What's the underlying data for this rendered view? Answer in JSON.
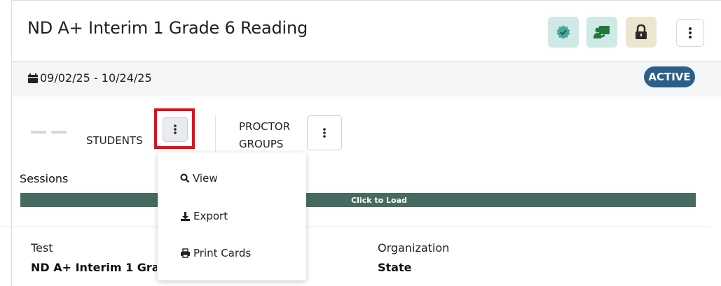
{
  "header": {
    "title": "ND A+ Interim 1 Grade 6 Reading",
    "icons": [
      "verified-badge-icon",
      "proctor-icon",
      "lock-icon",
      "more-vertical-icon"
    ]
  },
  "datebar": {
    "date_range": "09/02/25 - 10/24/25",
    "status": "ACTIVE"
  },
  "stats": {
    "students_label": "STUDENTS",
    "proctor_groups_line1": "PROCTOR",
    "proctor_groups_line2": "GROUPS"
  },
  "sessions": {
    "label": "Sessions",
    "load_label": "Click to Load"
  },
  "dropdown": {
    "items": [
      {
        "label": "View",
        "icon": "search-icon"
      },
      {
        "label": "Export",
        "icon": "download-icon"
      },
      {
        "label": "Print Cards",
        "icon": "print-icon"
      }
    ]
  },
  "fields": {
    "test_label": "Test",
    "test_value": "ND A+ Interim 1 Gra",
    "org_label": "Organization",
    "org_value": "State"
  },
  "colors": {
    "active_badge": "#2b5f8a",
    "load_bar": "#476a60",
    "highlight": "#e0101a"
  }
}
